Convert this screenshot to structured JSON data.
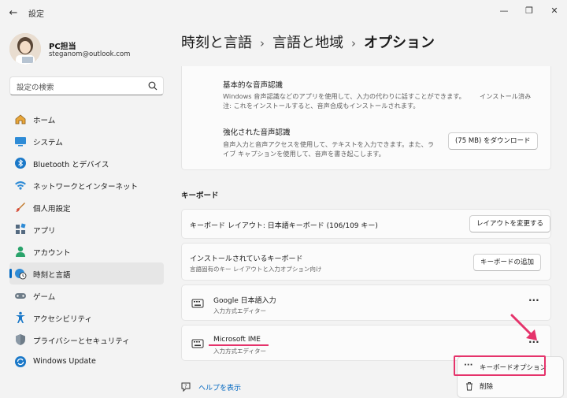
{
  "app": {
    "title": "設定"
  },
  "profile": {
    "name": "PC担当",
    "email": "steganom@outlook.com"
  },
  "search": {
    "placeholder": "設定の検索"
  },
  "sidebar": {
    "items": [
      {
        "label": "ホーム",
        "icon": "home-icon"
      },
      {
        "label": "システム",
        "icon": "system-icon"
      },
      {
        "label": "Bluetooth とデバイス",
        "icon": "bluetooth-icon"
      },
      {
        "label": "ネットワークとインターネット",
        "icon": "wifi-icon"
      },
      {
        "label": "個人用設定",
        "icon": "brush-icon"
      },
      {
        "label": "アプリ",
        "icon": "apps-icon"
      },
      {
        "label": "アカウント",
        "icon": "account-icon"
      },
      {
        "label": "時刻と言語",
        "icon": "clock-globe-icon",
        "active": true
      },
      {
        "label": "ゲーム",
        "icon": "gamepad-icon"
      },
      {
        "label": "アクセシビリティ",
        "icon": "accessibility-icon"
      },
      {
        "label": "プライバシーとセキュリティ",
        "icon": "shield-icon"
      },
      {
        "label": "Windows Update",
        "icon": "update-icon"
      }
    ]
  },
  "breadcrumb": {
    "level1": "時刻と言語",
    "level2": "言語と地域",
    "current": "オプション",
    "sep": "›"
  },
  "speech": {
    "basic_title": "基本的な音声認識",
    "basic_desc": "Windows 音声認識などのアプリを使用して、入力の代わりに話すことができます。",
    "basic_note": "注: これをインストールすると、音声合成もインストールされます。",
    "basic_status": "インストール済み",
    "enhanced_title": "強化された音声認識",
    "enhanced_desc_1": "音声入力と音声アクセスを使用して、テキストを入力できます。また、ラ",
    "enhanced_desc_2": "イブ キャプションを使用して、音声を書き起こします。",
    "download_label": "(75 MB) をダウンロード"
  },
  "keyboard": {
    "section_title": "キーボード",
    "layout_label": "キーボード レイアウト: 日本語キーボード (106/109 キー)",
    "change_layout_label": "レイアウトを変更する",
    "installed_title": "インストールされているキーボード",
    "installed_desc": "言語固有のキー レイアウトと入力オプション向け",
    "add_keyboard_label": "キーボードの追加",
    "items": [
      {
        "name": "Google 日本語入力",
        "desc": "入力方式エディター"
      },
      {
        "name": "Microsoft IME",
        "desc": "入力方式エディター"
      }
    ],
    "more_label": "···"
  },
  "menu": {
    "options_label": "キーボードオプション",
    "delete_label": "削除",
    "dots": "···"
  },
  "help": {
    "label": "ヘルプを表示"
  },
  "colors": {
    "accent": "#0067c0",
    "highlight": "#e5336b"
  }
}
